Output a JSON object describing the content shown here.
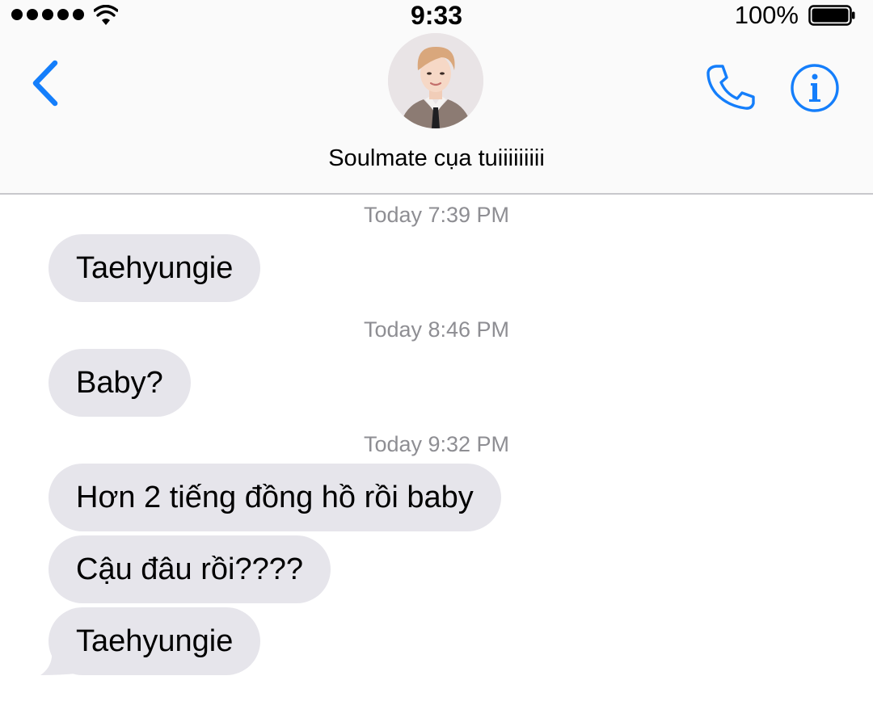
{
  "status_bar": {
    "time": "9:33",
    "battery_percent": "100%",
    "signal_icon": "signal-dots-icon",
    "wifi_icon": "wifi-icon",
    "battery_icon": "battery-icon"
  },
  "nav": {
    "back_icon": "chevron-left-icon",
    "contact_name": "Soulmate cụa tuiiiiiiiii",
    "avatar_icon": "contact-avatar",
    "call_icon": "phone-icon",
    "info_icon": "info-icon"
  },
  "colors": {
    "accent": "#147efb",
    "bubble_received": "#e6e5eb",
    "timestamp": "#8e8e93",
    "header_bg": "#fafafa"
  },
  "messages": {
    "timestamps": [
      "Today 7:39 PM",
      "Today 8:46 PM",
      "Today 9:32 PM"
    ],
    "bubbles": [
      "Taehyungie",
      "Baby?",
      "Hơn 2 tiếng đồng hồ rồi baby",
      "Cậu đâu rồi????",
      "Taehyungie"
    ]
  }
}
